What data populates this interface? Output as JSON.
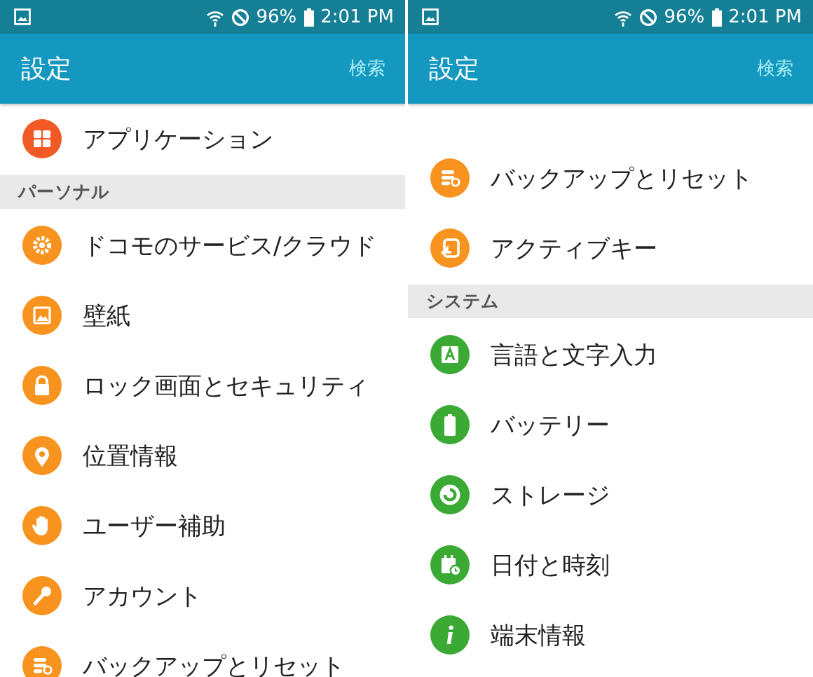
{
  "screens": [
    {
      "status_bar": {
        "battery": "96%",
        "time": "2:01 PM"
      },
      "app_bar": {
        "title": "設定",
        "action": "検索"
      },
      "list": [
        {
          "kind": "item",
          "label": "アプリケーション",
          "color": "#f15a24"
        },
        {
          "kind": "header",
          "label": "パーソナル"
        },
        {
          "kind": "item",
          "label": "ドコモのサービス/クラウド",
          "color": "#f7931e"
        },
        {
          "kind": "item",
          "label": "壁紙",
          "color": "#f7931e"
        },
        {
          "kind": "item",
          "label": "ロック画面とセキュリティ",
          "color": "#f7931e"
        },
        {
          "kind": "item",
          "label": "位置情報",
          "color": "#f7931e"
        },
        {
          "kind": "item",
          "label": "ユーザー補助",
          "color": "#f7931e"
        },
        {
          "kind": "item",
          "label": "アカウント",
          "color": "#f7931e"
        },
        {
          "kind": "item",
          "label": "バックアップとリセット",
          "color": "#f7931e"
        }
      ]
    },
    {
      "status_bar": {
        "battery": "96%",
        "time": "2:01 PM"
      },
      "app_bar": {
        "title": "設定",
        "action": "検索"
      },
      "list": [
        {
          "kind": "item",
          "label": "バックアップとリセット",
          "color": "#f7931e"
        },
        {
          "kind": "item",
          "label": "アクティブキー",
          "color": "#f7931e"
        },
        {
          "kind": "header",
          "label": "システム"
        },
        {
          "kind": "item",
          "label": "言語と文字入力",
          "color": "#3aaa35"
        },
        {
          "kind": "item",
          "label": "バッテリー",
          "color": "#3aaa35"
        },
        {
          "kind": "item",
          "label": "ストレージ",
          "color": "#3aaa35"
        },
        {
          "kind": "item",
          "label": "日付と時刻",
          "color": "#3aaa35"
        },
        {
          "kind": "item",
          "label": "端末情報",
          "color": "#3aaa35"
        }
      ]
    }
  ]
}
